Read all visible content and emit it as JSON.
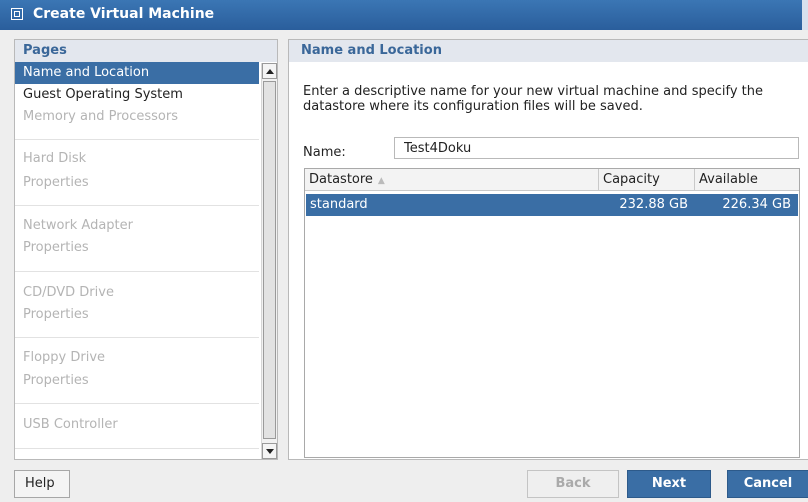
{
  "window": {
    "title": "Create Virtual Machine",
    "icon": "vm-window-icon"
  },
  "pages_panel": {
    "header": "Pages",
    "items": [
      {
        "label": "Name and Location",
        "state": "selected"
      },
      {
        "label": "Guest Operating System",
        "state": "enabled"
      },
      {
        "label": "Memory and Processors",
        "state": "disabled"
      },
      {
        "label": "Hard Disk",
        "state": "disabled"
      },
      {
        "label": "Properties",
        "state": "disabled"
      },
      {
        "label": "Network Adapter",
        "state": "disabled"
      },
      {
        "label": "Properties",
        "state": "disabled"
      },
      {
        "label": "CD/DVD Drive",
        "state": "disabled"
      },
      {
        "label": "Properties",
        "state": "disabled"
      },
      {
        "label": "Floppy Drive",
        "state": "disabled"
      },
      {
        "label": "Properties",
        "state": "disabled"
      },
      {
        "label": "USB Controller",
        "state": "disabled"
      }
    ]
  },
  "content": {
    "header": "Name and Location",
    "description_line1": "Enter a descriptive name for your new virtual machine and specify the",
    "description_line2": "datastore where its configuration files will be saved.",
    "name_label": "Name:",
    "name_value": "Test4Doku",
    "table": {
      "columns": [
        "Datastore",
        "Capacity",
        "Available"
      ],
      "sort_indicator": "▲",
      "rows": [
        {
          "datastore": "standard",
          "capacity": "232.88 GB",
          "available": "226.34 GB",
          "selected": true
        }
      ]
    }
  },
  "buttons": {
    "help": "Help",
    "back": "Back",
    "next": "Next",
    "cancel": "Cancel"
  },
  "colors": {
    "selection": "#3a6ea5",
    "header_text": "#3a6799",
    "title_bar": "#2a5e9c"
  }
}
